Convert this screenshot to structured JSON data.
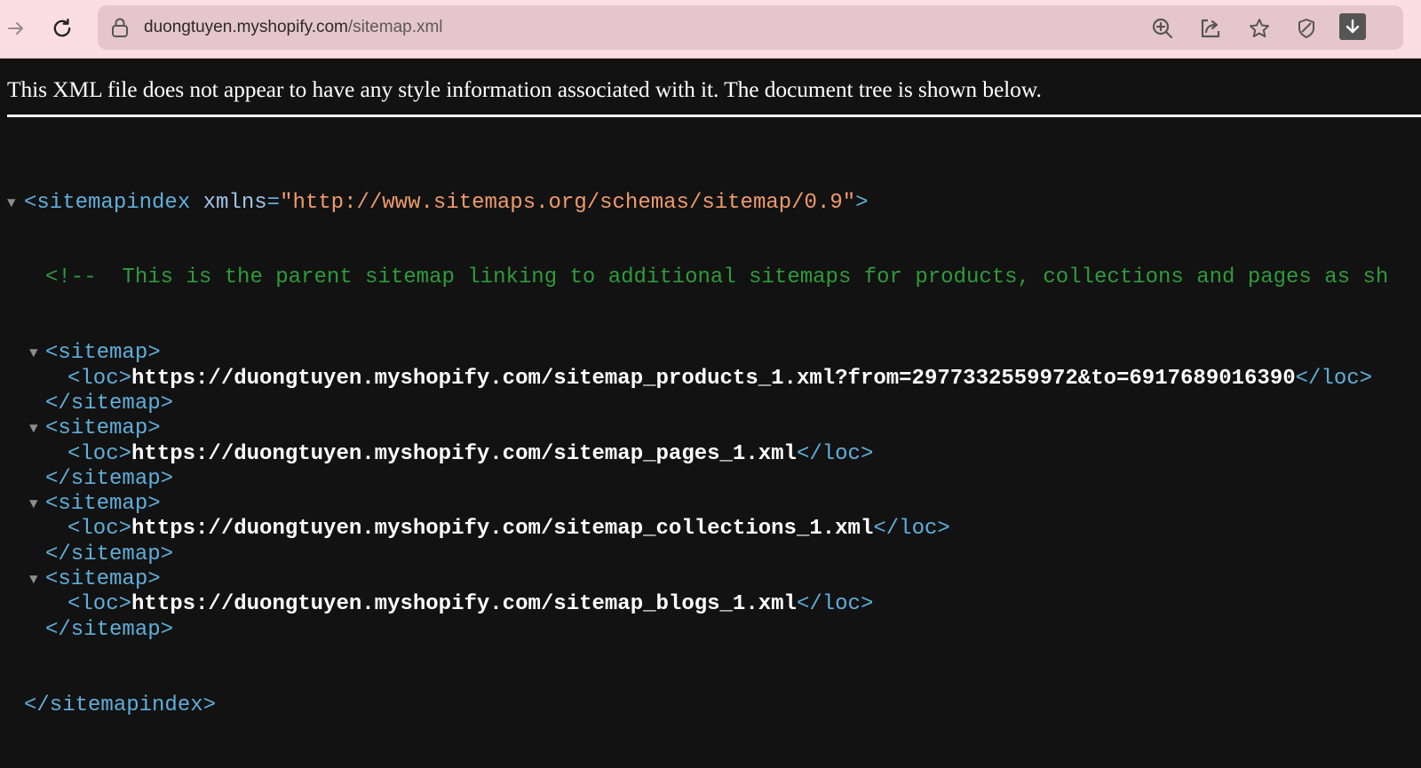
{
  "browser": {
    "url_host": "duongtuyen.myshopify.com",
    "url_path": "/sitemap.xml",
    "icons": [
      "forward-arrow-icon",
      "reload-icon",
      "lock-icon",
      "zoom-in-icon",
      "share-icon",
      "bookmark-star-icon",
      "shield-icon",
      "download-icon"
    ]
  },
  "page": {
    "notice": "This XML file does not appear to have any style information associated with it. The document tree is shown below.",
    "root_open": "<sitemapindex",
    "root_attr_name": "xmlns",
    "root_attr_eq": "=",
    "root_attr_value": "\"http://www.sitemaps.org/schemas/sitemap/0.9\"",
    "root_open_end": ">",
    "comment": "<!--  This is the parent sitemap linking to additional sitemaps for products, collections and pages as sh",
    "sitemap_open": "<sitemap>",
    "sitemap_close": "</sitemap>",
    "loc_open": "<loc>",
    "loc_close": "</loc>",
    "root_close": "</sitemapindex>",
    "toggle_glyph": "▼",
    "sitemaps": [
      {
        "loc": "https://duongtuyen.myshopify.com/sitemap_products_1.xml?from=2977332559972&to=6917689016390"
      },
      {
        "loc": "https://duongtuyen.myshopify.com/sitemap_pages_1.xml"
      },
      {
        "loc": "https://duongtuyen.myshopify.com/sitemap_collections_1.xml"
      },
      {
        "loc": "https://duongtuyen.myshopify.com/sitemap_blogs_1.xml"
      }
    ]
  }
}
